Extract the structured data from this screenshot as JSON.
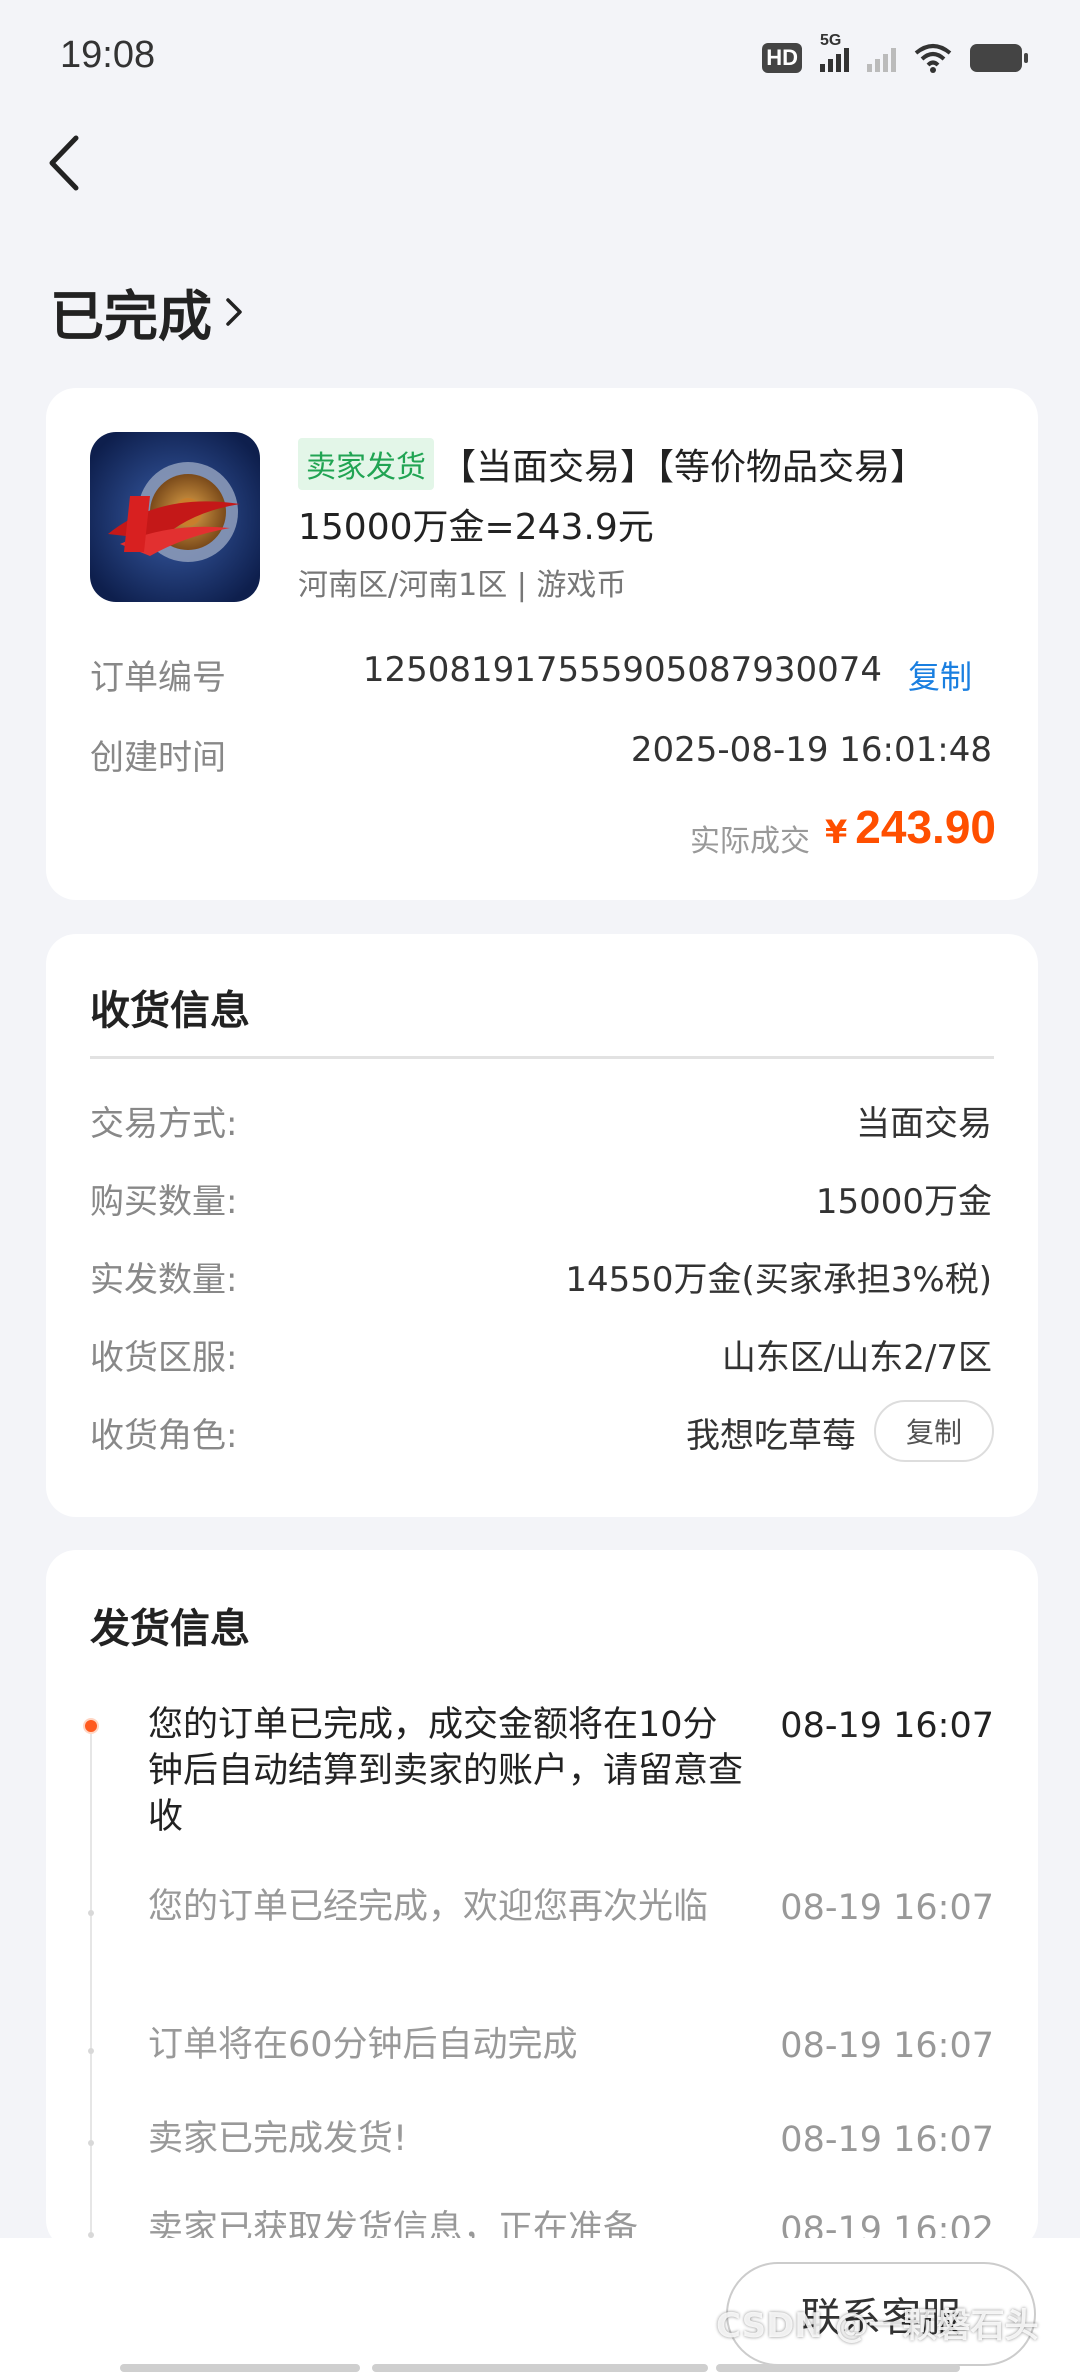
{
  "status_bar": {
    "time": "19:08",
    "hd": "HD",
    "net": "5G"
  },
  "header": {
    "title": "已完成"
  },
  "order": {
    "tag": "卖家发货",
    "title": "【当面交易】【等价物品交易】",
    "price_line": "15000万金=243.9元",
    "server_line": "河南区/河南1区 | 游戏币",
    "order_no_label": "订单编号",
    "order_no": "1250819175559050879300​74",
    "copy_label": "复制",
    "created_label": "创建时间",
    "created_time": "2025-08-19 16:01:48",
    "actual_label": "实际成交",
    "currency": "¥",
    "actual_amount": "243.90",
    "accent_color": "#ff4f00"
  },
  "receive": {
    "title": "收货信息",
    "rows": [
      {
        "label": "交易方式:",
        "value": "当面交易"
      },
      {
        "label": "购买数量:",
        "value": "15000万金"
      },
      {
        "label": "实发数量:",
        "value": "14550万金(买家承担3%税)"
      },
      {
        "label": "收货区服:",
        "value": "山东区/山东2/7区"
      },
      {
        "label": "收货角色:",
        "value": "我想吃草莓"
      }
    ],
    "copy_label": "复制"
  },
  "ship": {
    "title": "发货信息",
    "events": [
      {
        "text": "您的订单已完成，成交金额将在10分钟后自动结算到卖家的账户，请留意查收",
        "time": "08-19 16:07"
      },
      {
        "text": "您的订单已经完成，欢迎您再次光临",
        "time": "08-19 16:07"
      },
      {
        "text": "订单将在60分钟后自动完成",
        "time": "08-19 16:07"
      },
      {
        "text": "卖家已完成发货!",
        "time": "08-19 16:07"
      },
      {
        "text": "卖家已获取发货信息，正在准备",
        "time": "08-19 16:02"
      }
    ]
  },
  "bottom": {
    "contact_label": "联系客服",
    "watermark": "CSDN @一颗磐石头"
  }
}
